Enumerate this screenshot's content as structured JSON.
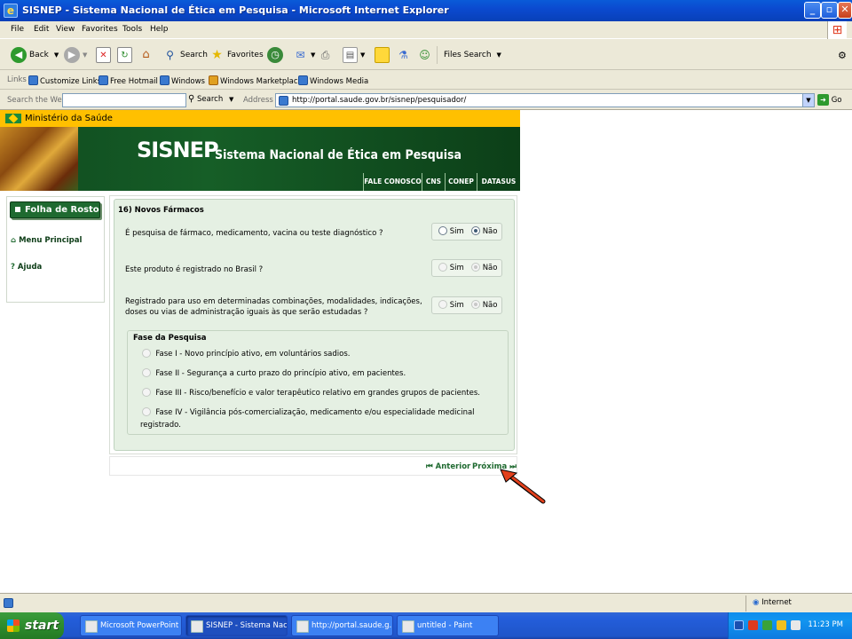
{
  "window": {
    "title": "SISNEP - Sistema Nacional de Ética em Pesquisa - Microsoft Internet Explorer"
  },
  "menu": [
    "File",
    "Edit",
    "View",
    "Favorites",
    "Tools",
    "Help"
  ],
  "toolbar": {
    "back": "Back",
    "search": "Search",
    "favorites": "Favorites",
    "files_search": "Files Search"
  },
  "links": {
    "label": "Links",
    "items": [
      "Customize Links",
      "Free Hotmail",
      "Windows",
      "Windows Marketplace",
      "Windows Media"
    ]
  },
  "address": {
    "search_placeholder": "Search the Web",
    "search_button": "Search",
    "label": "Address",
    "url": "http://portal.saude.gov.br/sisnep/pesquisador/",
    "go": "Go"
  },
  "site": {
    "ministry": "Ministério da Saúde",
    "logo": "SISNEP",
    "full_name": "Sistema Nacional de Ética em Pesquisa",
    "nav": [
      "FALE CONOSCO",
      "CNS",
      "CONEP",
      "DATASUS"
    ]
  },
  "sidebar": {
    "header": "Folha de Rosto",
    "items": [
      "Menu Principal",
      "Ajuda"
    ]
  },
  "form": {
    "section_title": "16) Novos Fármacos",
    "questions": [
      {
        "text": "É pesquisa de fármaco, medicamento, vacina ou teste diagnóstico ?",
        "yes": "Sim",
        "no": "Não",
        "selected": "no",
        "enabled": true
      },
      {
        "text": "Este produto é registrado no Brasil ?",
        "yes": "Sim",
        "no": "Não",
        "selected": "no",
        "enabled": false
      },
      {
        "text_line1": "Registrado para uso em determinadas combinações, modalidades, indicações,",
        "text_line2": "doses ou vias de administração iguais às que serão estudadas ?",
        "yes": "Sim",
        "no": "Não",
        "selected": "no",
        "enabled": false
      }
    ],
    "phase": {
      "title": "Fase da Pesquisa",
      "options": [
        "Fase I - Novo princípio ativo, em voluntários sadios.",
        "Fase II - Segurança a curto prazo do princípio ativo, em pacientes.",
        "Fase III - Risco/benefício e valor terapêutico relativo em grandes grupos de pacientes.",
        "Fase IV - Vigilância pós-comercialização, medicamento e/ou especialidade medicinal"
      ],
      "option4_line2": "registrado."
    }
  },
  "pager": {
    "prev": "Anterior",
    "next": "Próxima"
  },
  "status": {
    "zone": "Internet"
  },
  "taskbar": {
    "start": "start",
    "tasks": [
      "Microsoft PowerPoint ...",
      "SISNEP - Sistema Nac...",
      "http://portal.saude.g...",
      "untitled - Paint"
    ],
    "clock": "11:23 PM"
  },
  "colors": {
    "site_green": "#165e27",
    "ministry_yellow": "#ffc000",
    "form_bg": "#e5f0e3",
    "annotation_arrow": "#e2401c"
  }
}
